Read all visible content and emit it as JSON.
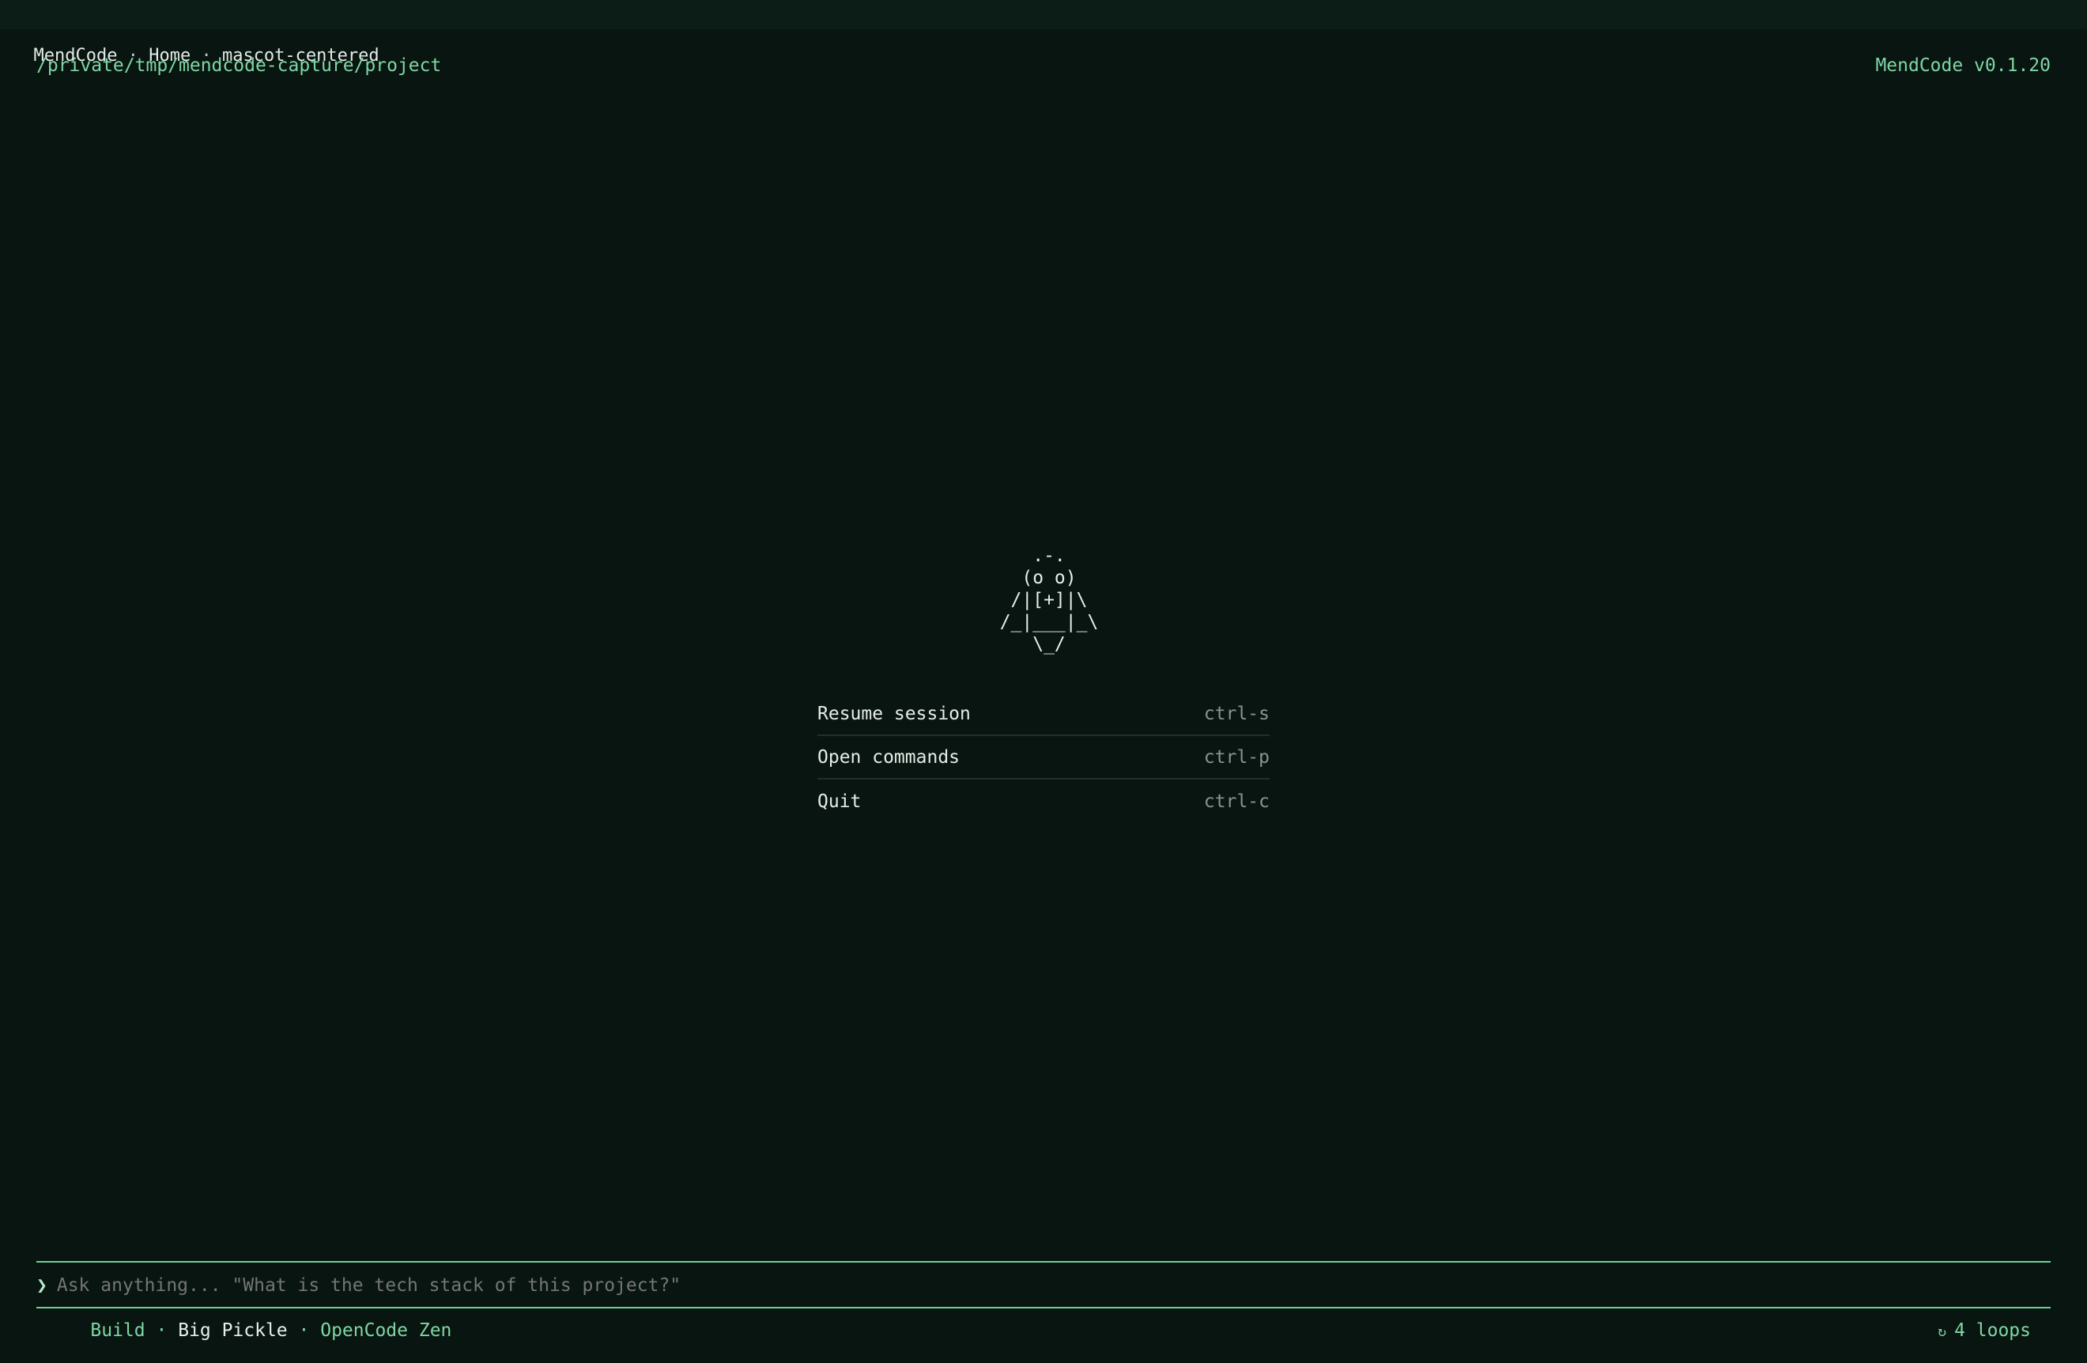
{
  "titlebar": {
    "app": "MendCode",
    "sep1": " · ",
    "page": "Home",
    "sep2": " · ",
    "variant": "mascot-centered"
  },
  "header": {
    "path": "/private/tmp/mendcode-capture/project",
    "version": "MendCode v0.1.20"
  },
  "mascot": {
    "lines": [
      ".-.",
      "(o o)",
      "/|[+]|\\",
      "/_|___|_\\",
      "\\_/"
    ]
  },
  "menu": {
    "items": [
      {
        "label": "Resume session",
        "shortcut": "ctrl-s"
      },
      {
        "label": "Open commands",
        "shortcut": "ctrl-p"
      },
      {
        "label": "Quit",
        "shortcut": "ctrl-c"
      }
    ]
  },
  "prompt": {
    "chevron": "❯",
    "placeholder": "Ask anything... \"What is the tech stack of this project?\""
  },
  "status": {
    "mode": "Build",
    "dot": " · ",
    "model": "Big Pickle",
    "provider": "OpenCode Zen",
    "loops_icon": "↻",
    "loops": "4 loops"
  },
  "colors": {
    "background": "#081510",
    "accent": "#7fd6a4",
    "text": "#e8eee9",
    "muted": "#8b948f"
  }
}
